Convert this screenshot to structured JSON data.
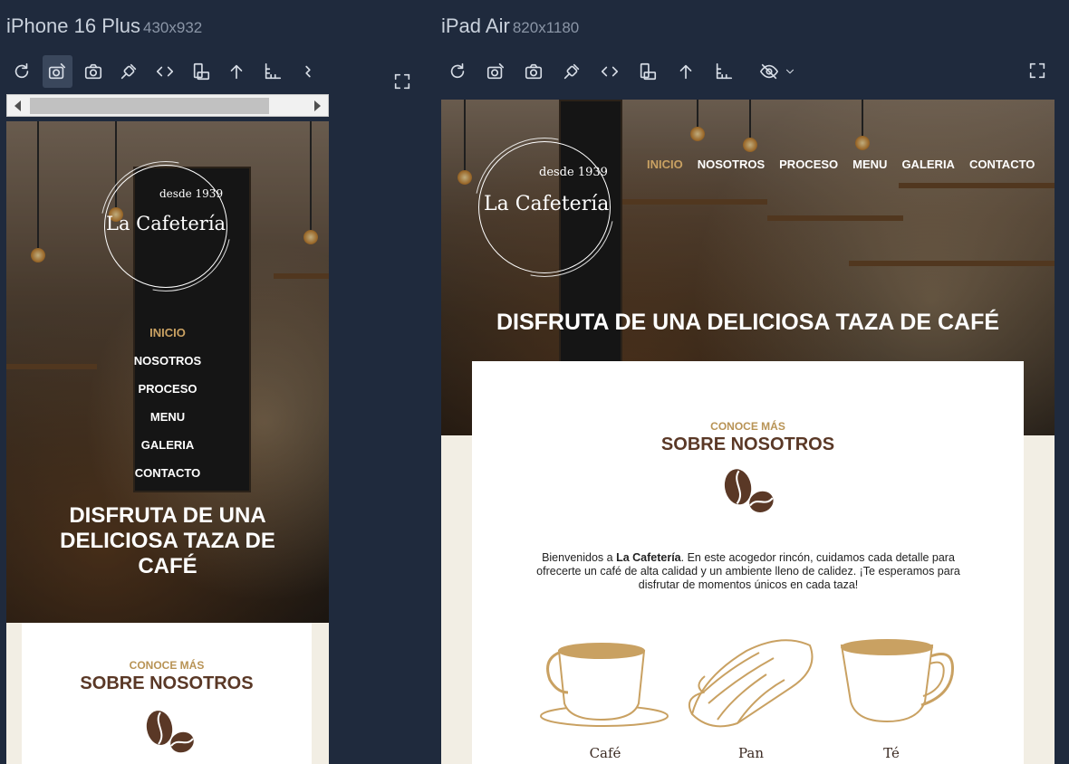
{
  "devices": {
    "phone": {
      "name": "iPhone 16 Plus",
      "size": "430x932"
    },
    "tablet": {
      "name": "iPad Air",
      "size": "820x1180"
    }
  },
  "toolbar_icons": [
    "reload-icon",
    "screenshot-edit-icon",
    "camera-icon",
    "plug-icon",
    "code-icon",
    "rotate-icon",
    "up-arrow-icon",
    "ruler-icon",
    "hide-icon",
    "chevron-down-icon",
    "expand-icon"
  ],
  "site": {
    "logo_since": "desde 1939",
    "logo_brand": "La Cafetería",
    "nav": [
      "INICIO",
      "NOSOTROS",
      "PROCESO",
      "MENU",
      "GALERIA",
      "CONTACTO"
    ],
    "hero_title": "DISFRUTA DE UNA DELICIOSA TAZA DE CAFÉ",
    "about_kicker": "CONOCE MÁS",
    "about_heading": "SOBRE NOSOTROS",
    "intro_before": "Bienvenidos a ",
    "intro_brand": "La Cafetería",
    "intro_after": ". En este acogedor rincón, cuidamos cada detalle para ofrecerte un café de alta calidad y un ambiente lleno de calidez. ¡Te esperamos para disfrutar de momentos únicos en cada taza!",
    "products": [
      "Café",
      "Pan",
      "Té"
    ]
  },
  "colors": {
    "accent": "#c9a162",
    "heading": "#5a3826",
    "kicker": "#b89355",
    "panel": "#1f2a3d"
  }
}
